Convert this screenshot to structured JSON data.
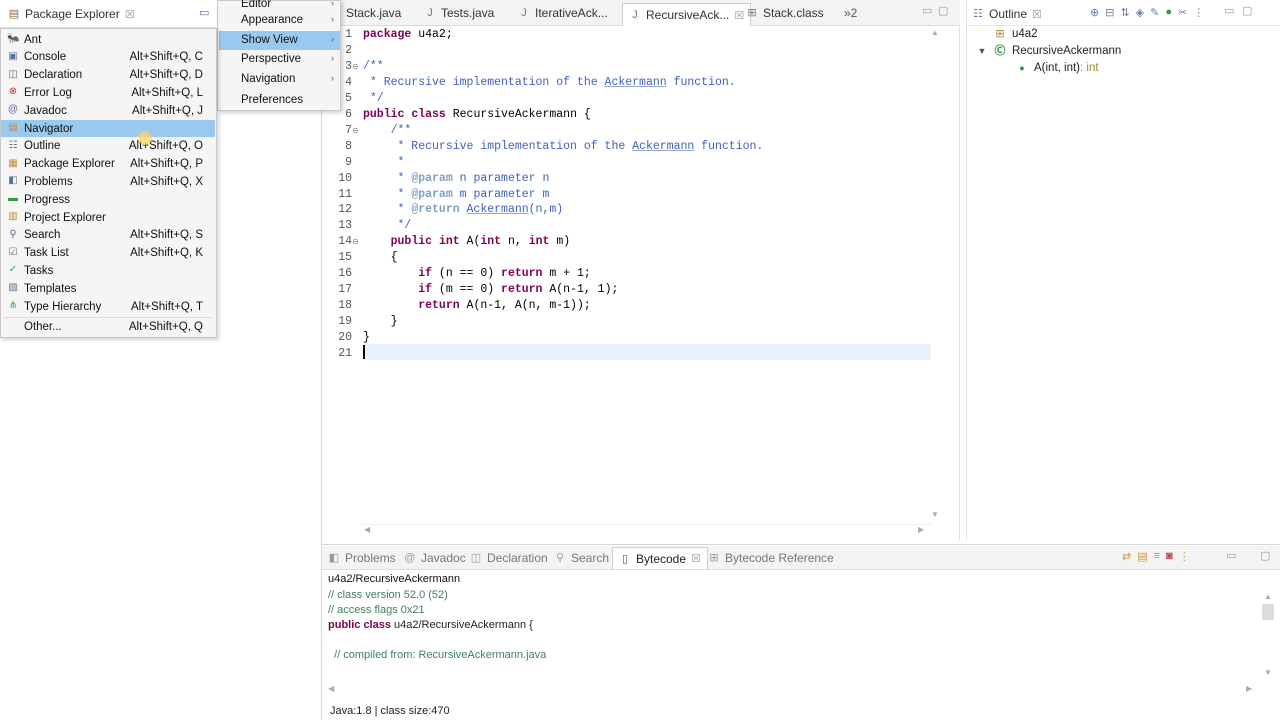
{
  "package_explorer": {
    "title": "Package Explorer",
    "close": "☒"
  },
  "window_menu": {
    "items": [
      {
        "label": "Editor",
        "submenu": true
      },
      {
        "label": "Appearance",
        "submenu": true
      },
      {
        "label": "Show View",
        "submenu": true,
        "highlighted": true
      },
      {
        "label": "Perspective",
        "submenu": true
      },
      {
        "label": "Navigation",
        "submenu": true
      },
      {
        "label": "Preferences",
        "submenu": false
      }
    ]
  },
  "show_view_menu": {
    "items": [
      {
        "label": "Ant",
        "shortcut": "",
        "icon": "ant-icon"
      },
      {
        "label": "Console",
        "shortcut": "Alt+Shift+Q, C",
        "icon": "console-icon"
      },
      {
        "label": "Declaration",
        "shortcut": "Alt+Shift+Q, D",
        "icon": "declaration-icon"
      },
      {
        "label": "Error Log",
        "shortcut": "Alt+Shift+Q, L",
        "icon": "error-log-icon"
      },
      {
        "label": "Javadoc",
        "shortcut": "Alt+Shift+Q, J",
        "icon": "javadoc-icon"
      },
      {
        "label": "Navigator",
        "shortcut": "",
        "icon": "navigator-icon"
      },
      {
        "label": "Outline",
        "shortcut": "Alt+Shift+Q, O",
        "icon": "outline-icon"
      },
      {
        "label": "Package Explorer",
        "shortcut": "Alt+Shift+Q, P",
        "icon": "package-explorer-icon"
      },
      {
        "label": "Problems",
        "shortcut": "Alt+Shift+Q, X",
        "icon": "problems-icon"
      },
      {
        "label": "Progress",
        "shortcut": "",
        "icon": "progress-icon"
      },
      {
        "label": "Project Explorer",
        "shortcut": "",
        "icon": "project-explorer-icon"
      },
      {
        "label": "Search",
        "shortcut": "Alt+Shift+Q, S",
        "icon": "search-icon"
      },
      {
        "label": "Task List",
        "shortcut": "Alt+Shift+Q, K",
        "icon": "task-list-icon"
      },
      {
        "label": "Tasks",
        "shortcut": "",
        "icon": "tasks-icon"
      },
      {
        "label": "Templates",
        "shortcut": "",
        "icon": "templates-icon"
      },
      {
        "label": "Type Hierarchy",
        "shortcut": "Alt+Shift+Q, T",
        "icon": "type-hierarchy-icon"
      },
      {
        "label": "Other...",
        "shortcut": "Alt+Shift+Q, Q",
        "icon": ""
      }
    ],
    "highlighted": "Navigator"
  },
  "editor_tabs": [
    {
      "label": "Stack.java",
      "active": false
    },
    {
      "label": "Tests.java",
      "active": false
    },
    {
      "label": "IterativeAck...",
      "active": false
    },
    {
      "label": "RecursiveAck...",
      "active": true
    },
    {
      "label": "Stack.class",
      "active": false
    },
    {
      "label": "»2",
      "active": false
    }
  ],
  "editor": {
    "line_numbers": [
      "1",
      "2",
      "3",
      "4",
      "5",
      "6",
      "7",
      "8",
      "9",
      "10",
      "11",
      "12",
      "13",
      "14",
      "15",
      "16",
      "17",
      "18",
      "19",
      "20",
      "21"
    ],
    "lines": [
      "package u4a2;",
      "",
      "/**",
      " * Recursive implementation of the Ackermann function.",
      " */",
      "public class RecursiveAckermann {",
      "    /**",
      "     * Recursive implementation of the Ackermann function.",
      "     *",
      "     * @param n parameter n",
      "     * @param m parameter m",
      "     * @return Ackermann(n,m)",
      "     */",
      "    public int A(int n, int m)",
      "    {",
      "        if (n == 0) return m + 1;",
      "        if (m == 0) return A(n-1, 1);",
      "        return A(n-1, A(n, m-1));",
      "    }",
      "}",
      ""
    ]
  },
  "outline": {
    "title": "Outline",
    "items": [
      {
        "label": "u4a2",
        "icon": "package-declaration-icon",
        "level": 0
      },
      {
        "label": "RecursiveAckermann",
        "icon": "class-icon",
        "level": 0
      },
      {
        "label": "A(int, int)",
        "type": " : int",
        "icon": "public-method-icon",
        "level": 1
      }
    ]
  },
  "bottom_tabs": [
    {
      "label": "Problems",
      "active": false
    },
    {
      "label": "Javadoc",
      "active": false
    },
    {
      "label": "Declaration",
      "active": false
    },
    {
      "label": "Search",
      "active": false
    },
    {
      "label": "Bytecode",
      "active": true
    },
    {
      "label": "Bytecode Reference",
      "active": false
    }
  ],
  "bytecode": {
    "class_path": "u4a2/RecursiveAckermann",
    "lines": [
      "// class version 52.0 (52)",
      "// access flags 0x21",
      "public class u4a2/RecursiveAckermann {",
      "",
      "  // compiled from: RecursiveAckermann.java"
    ],
    "status": "Java:1.8 | class size:470"
  },
  "colors": {
    "menu_highlight": "#99c9ef",
    "keyword": "#7f0055",
    "javadoc": "#3f5fbf",
    "current_line": "#e8f2fe"
  }
}
